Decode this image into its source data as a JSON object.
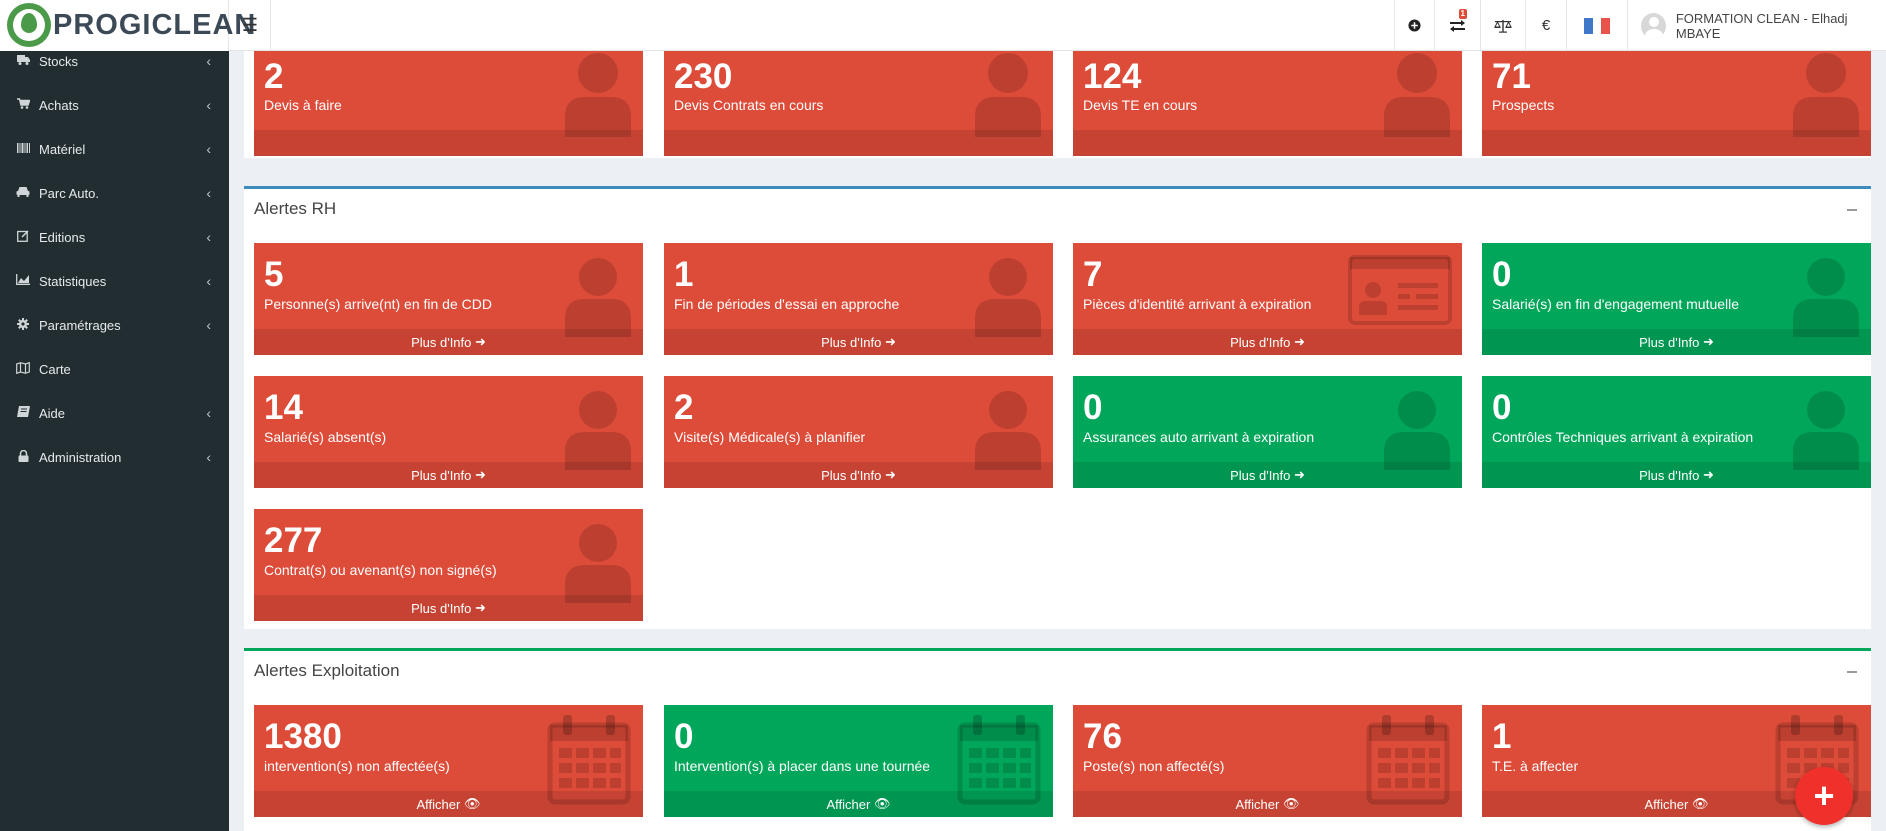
{
  "app": {
    "logo_text": "PROGICLEAN",
    "brand_color": "#4a9a4a"
  },
  "topbar": {
    "notification_count": "1",
    "currency_symbol": "€",
    "user_name": "FORMATION CLEAN - Elhadj MBAYE",
    "flag_colors": [
      "#3f78c9",
      "#ffffff",
      "#e8534a"
    ]
  },
  "sidebar": {
    "items": [
      {
        "label": "Stocks",
        "icon": "truck-icon"
      },
      {
        "label": "Achats",
        "icon": "cart-icon"
      },
      {
        "label": "Matériel",
        "icon": "barcode-icon"
      },
      {
        "label": "Parc Auto.",
        "icon": "car-icon"
      },
      {
        "label": "Editions",
        "icon": "edit-icon"
      },
      {
        "label": "Statistiques",
        "icon": "chart-icon"
      },
      {
        "label": "Paramétrages",
        "icon": "gear-icon"
      },
      {
        "label": "Carte",
        "icon": "map-icon"
      },
      {
        "label": "Aide",
        "icon": "book-icon"
      },
      {
        "label": "Administration",
        "icon": "lock-icon"
      }
    ]
  },
  "sections": {
    "commercial": {
      "tiles": [
        {
          "value": "2",
          "label": "Devis à faire",
          "color": "red"
        },
        {
          "value": "230",
          "label": "Devis Contrats en cours",
          "color": "red"
        },
        {
          "value": "124",
          "label": "Devis TE en cours",
          "color": "red"
        },
        {
          "value": "71",
          "label": "Prospects",
          "color": "red"
        }
      ]
    },
    "rh": {
      "title": "Alertes RH",
      "accent": "#3c8dbc",
      "footer_label": "Plus d'Info",
      "tiles": [
        {
          "value": "5",
          "label": "Personne(s) arrive(nt) en fin de CDD",
          "color": "red",
          "icon": "user-icon"
        },
        {
          "value": "1",
          "label": "Fin de périodes d'essai en approche",
          "color": "red",
          "icon": "user-icon"
        },
        {
          "value": "7",
          "label": "Pièces d'identité arrivant à expiration",
          "color": "red",
          "icon": "id-card-icon"
        },
        {
          "value": "0",
          "label": "Salarié(s) en fin d'engagement mutuelle",
          "color": "green",
          "icon": "user-icon"
        },
        {
          "value": "14",
          "label": "Salarié(s) absent(s)",
          "color": "red",
          "icon": "user-icon"
        },
        {
          "value": "2",
          "label": "Visite(s) Médicale(s) à planifier",
          "color": "red",
          "icon": "user-icon"
        },
        {
          "value": "0",
          "label": "Assurances auto arrivant à expiration",
          "color": "green",
          "icon": "user-icon"
        },
        {
          "value": "0",
          "label": "Contrôles Techniques arrivant à expiration",
          "color": "green",
          "icon": "user-icon"
        },
        {
          "value": "277",
          "label": "Contrat(s) ou avenant(s) non signé(s)",
          "color": "red",
          "icon": "user-icon"
        }
      ]
    },
    "exploitation": {
      "title": "Alertes Exploitation",
      "accent": "#00a65a",
      "footer_label": "Afficher",
      "tiles": [
        {
          "value": "1380",
          "label": "intervention(s) non affectée(s)",
          "color": "red",
          "icon": "calendar-icon"
        },
        {
          "value": "0",
          "label": "Intervention(s) à placer dans une tournée",
          "color": "green",
          "icon": "calendar-icon"
        },
        {
          "value": "76",
          "label": "Poste(s) non affecté(s)",
          "color": "red",
          "icon": "calendar-icon"
        },
        {
          "value": "1",
          "label": "T.E. à affecter",
          "color": "red",
          "icon": "calendar-icon"
        }
      ]
    }
  },
  "fab": {
    "label": "+"
  }
}
